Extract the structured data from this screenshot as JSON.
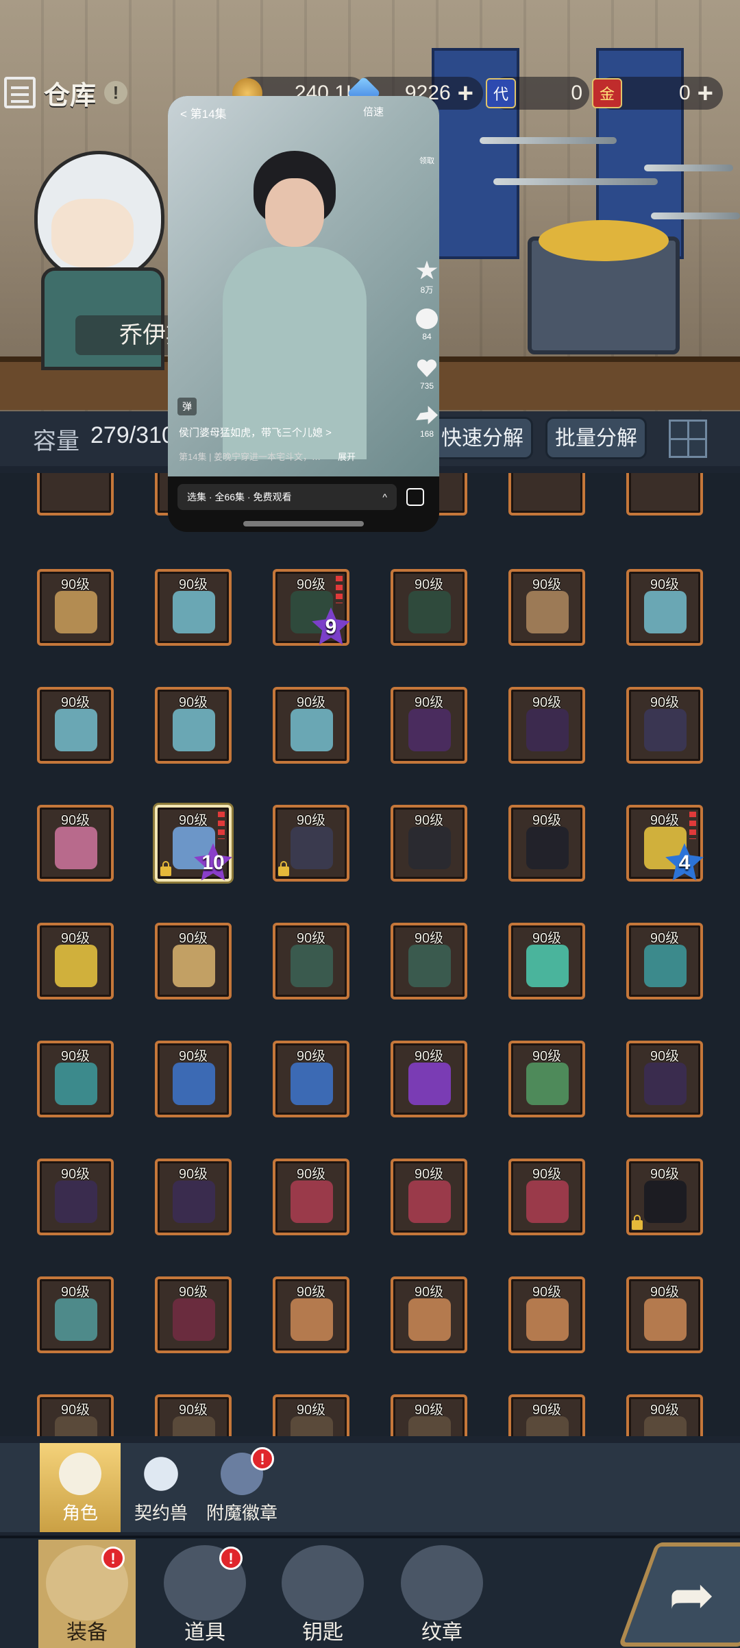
{
  "header": {
    "title": "仓库",
    "title_badge": "!",
    "resources": [
      {
        "icon": "coin-icon",
        "value": "240.1K",
        "has_plus": false
      },
      {
        "icon": "crystal-icon",
        "value": "9226",
        "has_plus": true
      },
      {
        "icon": "voucher-icon",
        "icon_text": "代",
        "value": "0",
        "has_plus": false
      },
      {
        "icon": "gold-card-icon",
        "icon_text": "金",
        "value": "0",
        "has_plus": true
      }
    ],
    "plus": "+"
  },
  "hero": {
    "name": "乔伊斯"
  },
  "capacity": {
    "label": "容量",
    "value": "279/310"
  },
  "actions": {
    "quick_disassemble": "快速分解",
    "batch_disassemble": "批量分解"
  },
  "video": {
    "episode": "< 第14集",
    "speed": "倍速",
    "side_top": "领取",
    "favorites": "8万",
    "comments": "84",
    "likes": "735",
    "shares": "168",
    "dan": "弹",
    "title": "侯门婆母猛如虎，带飞三个儿媳 >",
    "subtitle": "第14集 | 姜晚宁穿进一本宅斗文，…",
    "expand": "展开",
    "bar_text": "选集 · 全66集 · 免费观看",
    "bar_caret": "^"
  },
  "inventory": {
    "level_label": "90级",
    "rows": [
      [
        {
          "gear": "boots-icon",
          "color": "#b38c52"
        },
        {
          "gear": "amulet-icon",
          "color": "#6aa7b4"
        },
        {
          "gear": "dark-sword-icon",
          "color": "#2f4a3c",
          "star": "9",
          "star_color": "#7b3fc9",
          "gems": true
        },
        {
          "gear": "dark-sword-icon",
          "color": "#2f4a3c"
        },
        {
          "gear": "fur-armor-icon",
          "color": "#9c7a56"
        },
        {
          "gear": "ring-icon",
          "color": "#6aa7b4"
        }
      ],
      [
        {
          "gear": "ring-icon",
          "color": "#6aa7b4"
        },
        {
          "gear": "ring-icon",
          "color": "#6aa7b4"
        },
        {
          "gear": "ring-icon",
          "color": "#6aa7b4"
        },
        {
          "gear": "mask-icon",
          "color": "#4a2c5e"
        },
        {
          "gear": "dark-armor-icon",
          "color": "#3c2a4e"
        },
        {
          "gear": "greaves-icon",
          "color": "#3a3652"
        }
      ],
      [
        {
          "gear": "cursed-necklace-icon",
          "color": "#b86a8c"
        },
        {
          "gear": "crystal-sword-icon",
          "color": "#6c96c8",
          "star": "10",
          "star_color": "#8a3ec9",
          "gems": true,
          "locked": true,
          "selected": true
        },
        {
          "gear": "dark-ring-icon",
          "color": "#3a3a4e",
          "locked": true
        },
        {
          "gear": "gauntlet-icon",
          "color": "#2a2a30"
        },
        {
          "gear": "black-boots-icon",
          "color": "#22222a"
        },
        {
          "gear": "gold-sword-icon",
          "color": "#d0b03c",
          "star": "4",
          "star_color": "#2c74d8",
          "gems": true
        }
      ],
      [
        {
          "gear": "gold-sword-icon",
          "color": "#d0b03c"
        },
        {
          "gear": "ornate-sword-icon",
          "color": "#c2a064"
        },
        {
          "gear": "bracer-icon",
          "color": "#3a5a4e"
        },
        {
          "gear": "bracer-icon",
          "color": "#3a5a4e"
        },
        {
          "gear": "jade-helmet-icon",
          "color": "#4ab49c"
        },
        {
          "gear": "teal-amulet-icon",
          "color": "#3c8a8c"
        }
      ],
      [
        {
          "gear": "teal-amulet-icon",
          "color": "#3c8a8c"
        },
        {
          "gear": "blue-amulet-icon",
          "color": "#3c6ab4"
        },
        {
          "gear": "blue-amulet-icon",
          "color": "#3c6ab4"
        },
        {
          "gear": "gem-ring-icon",
          "color": "#7a3cb4"
        },
        {
          "gear": "bead-necklace-icon",
          "color": "#4e8a5a"
        },
        {
          "gear": "dark-cloak-icon",
          "color": "#3a2c4e"
        }
      ],
      [
        {
          "gear": "dark-cloak-icon",
          "color": "#3a2c4e"
        },
        {
          "gear": "dark-cloak-icon",
          "color": "#3a2c4e"
        },
        {
          "gear": "crimson-glove-icon",
          "color": "#9a3a4a"
        },
        {
          "gear": "crimson-glove-icon",
          "color": "#9a3a4a"
        },
        {
          "gear": "crimson-glove-icon",
          "color": "#9a3a4a"
        },
        {
          "gear": "white-boots-icon",
          "color": "#1c1c22",
          "locked": true
        }
      ],
      [
        {
          "gear": "teal-sword-icon",
          "color": "#4e8a8a"
        },
        {
          "gear": "crimson-cloak-icon",
          "color": "#6a2c3e"
        },
        {
          "gear": "horn-blade-icon",
          "color": "#b47a4e"
        },
        {
          "gear": "horn-blade-icon",
          "color": "#b47a4e"
        },
        {
          "gear": "horn-blade-icon",
          "color": "#b47a4e"
        },
        {
          "gear": "horn-blade-icon",
          "color": "#b47a4e"
        }
      ],
      [
        {
          "gear": "unknown-gear-icon",
          "color": "#5a4a3a"
        },
        {
          "gear": "unknown-gear-icon",
          "color": "#5a4a3a"
        },
        {
          "gear": "unknown-gear-icon",
          "color": "#5a4a3a"
        },
        {
          "gear": "unknown-gear-icon",
          "color": "#5a4a3a"
        },
        {
          "gear": "unknown-gear-icon",
          "color": "#5a4a3a"
        },
        {
          "gear": "unknown-gear-icon",
          "color": "#5a4a3a"
        }
      ]
    ]
  },
  "character_tabs": [
    {
      "label": "角色",
      "icon": "character-icon",
      "active": true
    },
    {
      "label": "契约兽",
      "icon": "paw-icon",
      "active": false
    },
    {
      "label": "附魔徽章",
      "icon": "enchant-emblem-icon",
      "active": false,
      "badge": "!"
    }
  ],
  "bottom_nav": [
    {
      "label": "装备",
      "icon": "equipment-icon",
      "active": true,
      "badge": "!"
    },
    {
      "label": "道具",
      "icon": "chest-icon",
      "active": false,
      "badge": "!"
    },
    {
      "label": "钥匙",
      "icon": "key-icon",
      "active": false
    },
    {
      "label": "纹章",
      "icon": "emblem-icon",
      "active": false
    }
  ],
  "go_arrow": "➦"
}
